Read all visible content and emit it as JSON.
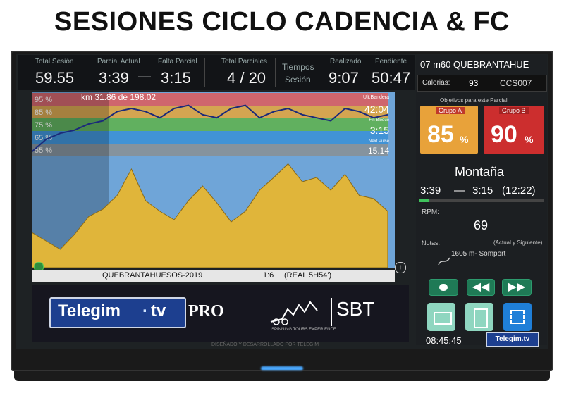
{
  "page_title": "SESIONES CICLO CADENCIA & FC",
  "top": {
    "total_sesion_label": "Total Sesión",
    "total_sesion_value": "59.55",
    "parcial_actual_label": "Parcial Actual",
    "parcial_actual_value": "3:39",
    "dash": "—",
    "falta_parcial_label": "Falta Parcial",
    "falta_parcial_value": "3:15",
    "total_parciales_label": "Total Parciales",
    "total_parciales_value": "4 / 20",
    "tiempos_label": "Tiempos",
    "sesion_label": "Sesión",
    "realizado_label": "Realizado",
    "realizado_value": "9:07",
    "pendiente_label": "Pendiente",
    "pendiente_value": "50:47"
  },
  "right": {
    "session_name": "07 m60 QUEBRANTAHUE",
    "calorias_label": "Calorias:",
    "calorias_value": "93",
    "code": "CCS007",
    "objetivos_label": "Objetivos para este Parcial",
    "grupo_a_label": "Grupo A",
    "grupo_a_value": "85",
    "grupo_b_label": "Grupo B",
    "grupo_b_value": "90",
    "percent": "%",
    "tipo": "Montaña",
    "parcial": "3:39",
    "dash": "—",
    "falta": "3:15",
    "falta_total": "(12:22)",
    "rpm_label": "RPM:",
    "rpm_value": "69",
    "notas_label": "Notas:",
    "notas_hint": "(Actual y Siguiente)",
    "nota_text": "1605 m- Somport",
    "clock": "08:45:45",
    "brand_small": "Telegim.tv"
  },
  "chart_data": {
    "type": "line",
    "zones": [
      "95 %",
      "85 %",
      "75 %",
      "65 %",
      "55 %"
    ],
    "zone_colors": [
      "#e05a5a",
      "#e6a53a",
      "#5fb24a",
      "#3a8fd6",
      "#8a8f94"
    ],
    "km_label": "km 31.86 de 198.02",
    "right_labels": {
      "ult_bandera": "Ult.Bandera",
      "ult_value": "42:04",
      "fin_bloque": "Fin Bloque",
      "fin_value": "3:15",
      "next_label": "Next Pulse",
      "next_value": "15.14"
    },
    "fc_series": [
      62,
      70,
      74,
      76,
      80,
      82,
      88,
      90,
      88,
      84,
      90,
      92,
      86,
      84,
      90,
      92,
      84,
      88,
      90,
      86,
      84,
      82,
      90,
      88,
      84,
      86
    ],
    "elevation_series": [
      0.7,
      0.78,
      0.86,
      0.72,
      0.55,
      0.48,
      0.35,
      0.1,
      0.4,
      0.5,
      0.58,
      0.4,
      0.26,
      0.42,
      0.6,
      0.5,
      0.3,
      0.18,
      0.05,
      0.22,
      0.18,
      0.3,
      0.15,
      0.35,
      0.38,
      0.5
    ]
  },
  "footer": {
    "route": "QUEBRANTAHUESOS-2019",
    "ratio": "1:6",
    "real": "(REAL 5H54')"
  },
  "logo": {
    "telegim": "Telegim",
    "dot": ".",
    "tv": "tv",
    "pro": "PRO",
    "sbt": "SBT",
    "sbt_sub": "SPINNING TOURS EXPERIENCE"
  },
  "tv_footer": "DISEÑADO Y DESARROLLADO POR TELEGIM"
}
